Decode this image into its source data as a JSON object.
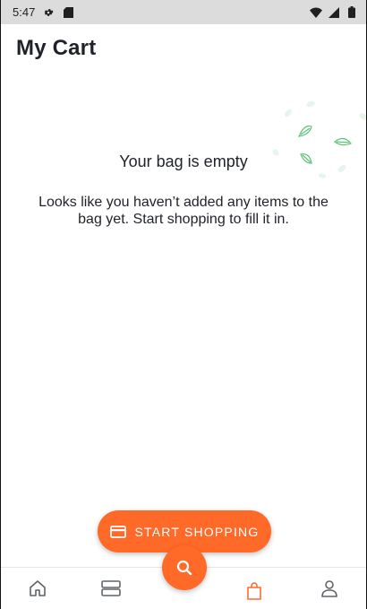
{
  "status_bar": {
    "time": "5:47",
    "icons": [
      "settings-icon",
      "sd-card-icon",
      "wifi-icon",
      "signal-icon",
      "battery-icon"
    ]
  },
  "page": {
    "title": "My Cart"
  },
  "empty_state": {
    "heading": "Your bag is empty",
    "message": "Looks like you haven’t added any items to the bag yet. Start shopping to fill it in."
  },
  "cta": {
    "label": "START SHOPPING",
    "icon": "card-icon"
  },
  "fab": {
    "icon": "search-icon"
  },
  "bottom_nav": {
    "items": [
      {
        "name": "home",
        "icon": "home-icon",
        "active": false
      },
      {
        "name": "categories",
        "icon": "categories-icon",
        "active": false
      },
      {
        "name": "bag",
        "icon": "shopping-bag-icon",
        "active": true
      },
      {
        "name": "profile",
        "icon": "person-icon",
        "active": false
      }
    ]
  },
  "colors": {
    "accent": "#ff6a29",
    "text": "#1f2229",
    "status_bar": "#dcdcdc",
    "leaf": "#5fc27a"
  }
}
